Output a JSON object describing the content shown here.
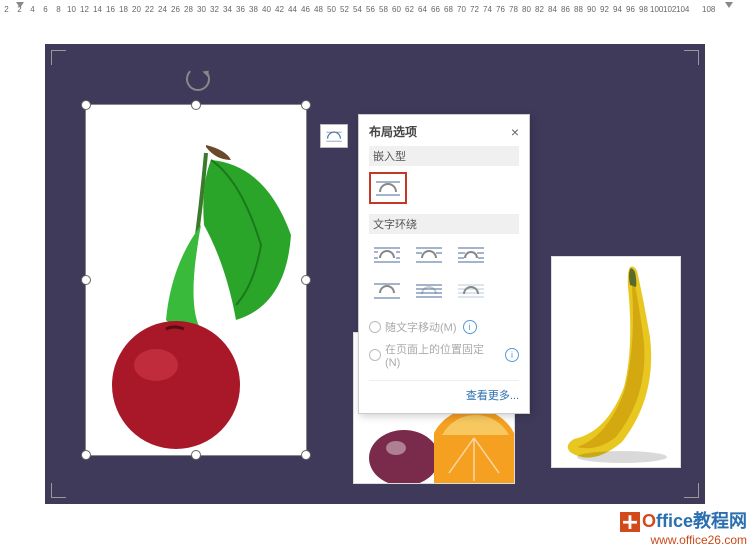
{
  "ruler": {
    "values": [
      "2",
      "2",
      "4",
      "6",
      "8",
      "10",
      "12",
      "14",
      "16",
      "18",
      "20",
      "22",
      "24",
      "26",
      "28",
      "30",
      "32",
      "34",
      "36",
      "38",
      "40",
      "42",
      "44",
      "46",
      "48",
      "50",
      "52",
      "54",
      "56",
      "58",
      "60",
      "62",
      "64",
      "66",
      "68",
      "70",
      "72",
      "74",
      "76",
      "78",
      "80",
      "82",
      "84",
      "86",
      "88",
      "90",
      "92",
      "94",
      "96",
      "98",
      "100",
      "102",
      "104",
      "",
      "108"
    ]
  },
  "layout_button": {
    "icon": "layout-options-icon"
  },
  "popup": {
    "title": "布局选项",
    "close": "×",
    "section_inline": "嵌入型",
    "section_wrap": "文字环绕",
    "radio_move": "随文字移动(M)",
    "radio_fixed": "在页面上的位置固定(N)",
    "info": "i",
    "more": "查看更多..."
  },
  "watermark": {
    "brand_o": "O",
    "brand_rest": "ffice教程网",
    "url": "www.office26.com"
  }
}
